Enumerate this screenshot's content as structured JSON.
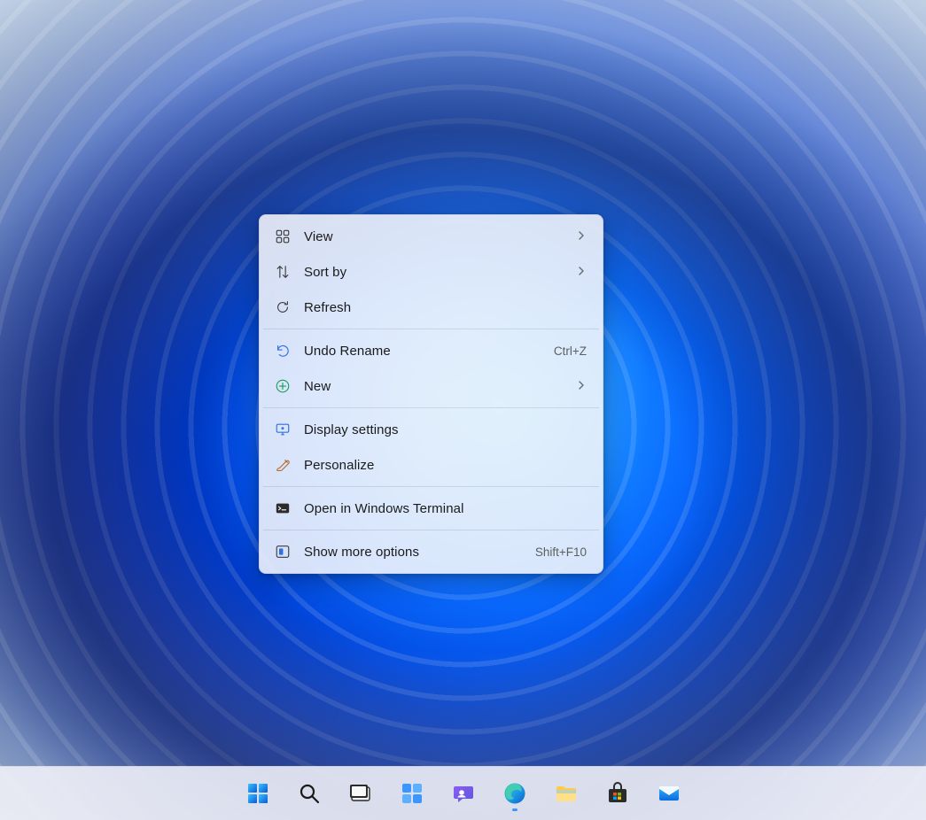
{
  "context_menu": {
    "items": [
      {
        "icon": "grid-icon",
        "label": "View",
        "accel": "",
        "submenu": true
      },
      {
        "icon": "sort-icon",
        "label": "Sort by",
        "accel": "",
        "submenu": true
      },
      {
        "icon": "refresh-icon",
        "label": "Refresh",
        "accel": "",
        "submenu": false
      },
      {
        "sep": true
      },
      {
        "icon": "undo-icon",
        "label": "Undo Rename",
        "accel": "Ctrl+Z",
        "submenu": false
      },
      {
        "icon": "new-icon",
        "label": "New",
        "accel": "",
        "submenu": true
      },
      {
        "sep": true
      },
      {
        "icon": "display-icon",
        "label": "Display settings",
        "accel": "",
        "submenu": false
      },
      {
        "icon": "personalize-icon",
        "label": "Personalize",
        "accel": "",
        "submenu": false
      },
      {
        "sep": true
      },
      {
        "icon": "terminal-icon",
        "label": "Open in Windows Terminal",
        "accel": "",
        "submenu": false
      },
      {
        "sep": true
      },
      {
        "icon": "more-icon",
        "label": "Show more options",
        "accel": "Shift+F10",
        "submenu": false
      }
    ]
  },
  "taskbar": {
    "buttons": [
      {
        "name": "start-button",
        "icon": "start-icon",
        "state": ""
      },
      {
        "name": "search-button",
        "icon": "search-icon",
        "state": ""
      },
      {
        "name": "taskview-button",
        "icon": "taskview-icon",
        "state": ""
      },
      {
        "name": "widgets-button",
        "icon": "widgets-icon",
        "state": ""
      },
      {
        "name": "chat-button",
        "icon": "chat-icon",
        "state": ""
      },
      {
        "name": "edge-button",
        "icon": "edge-icon",
        "state": "active"
      },
      {
        "name": "file-explorer-button",
        "icon": "file-explorer-icon",
        "state": ""
      },
      {
        "name": "store-button",
        "icon": "store-icon",
        "state": ""
      },
      {
        "name": "mail-button",
        "icon": "mail-icon",
        "state": ""
      }
    ]
  }
}
